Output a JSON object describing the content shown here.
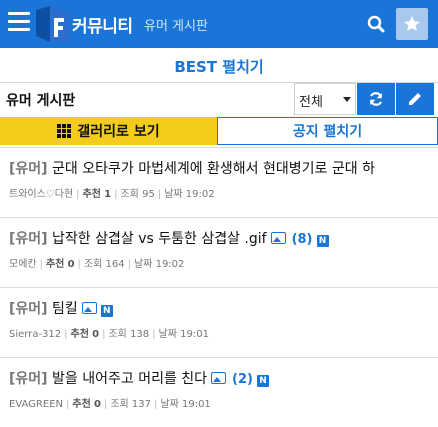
{
  "header": {
    "logo_text": "커뮤니티",
    "board_subtitle": "유머 게시판",
    "menu_icon": "hamburger-icon",
    "search_icon": "search-icon",
    "star_icon": "star-icon"
  },
  "best_toggle_label": "BEST 펼치기",
  "board_row": {
    "board_name": "유머 게시판",
    "select_value": "전체"
  },
  "toggles": {
    "gallery_label": "갤러리로 보기",
    "notice_label": "공지 펼치기"
  },
  "posts": [
    {
      "tag": "[유머]",
      "title": "군대 오타쿠가 마법세계에 환생해서 현대병기로 군대 하",
      "comments": "",
      "new_badge": "",
      "author": "트와이스♡다현",
      "recommend_label": "추천",
      "recommend": "1",
      "views_label": "조회",
      "views": "95",
      "date_label": "날짜",
      "date": "19:02",
      "has_image": false
    },
    {
      "tag": "[유머]",
      "title": "납작한 삼겹살 vs 두툼한 삼겹살 .gif",
      "comments": "(8)",
      "new_badge": "N",
      "author": "모에칸",
      "recommend_label": "추천",
      "recommend": "0",
      "views_label": "조회",
      "views": "164",
      "date_label": "날짜",
      "date": "19:02",
      "has_image": true
    },
    {
      "tag": "[유머]",
      "title": "팀킬",
      "comments": "",
      "new_badge": "N",
      "author": "Sierra-312",
      "recommend_label": "추천",
      "recommend": "0",
      "views_label": "조회",
      "views": "138",
      "date_label": "날짜",
      "date": "19:01",
      "has_image": true
    },
    {
      "tag": "[유머]",
      "title": "발을 내어주고 머리를 친다",
      "comments": "(2)",
      "new_badge": "N",
      "author": "EVAGREEN",
      "recommend_label": "추천",
      "recommend": "0",
      "views_label": "조회",
      "views": "137",
      "date_label": "날짜",
      "date": "19:01",
      "has_image": true
    }
  ],
  "colors": {
    "primary_blue": "#1976d8",
    "gallery_yellow": "#f5cc1b"
  }
}
